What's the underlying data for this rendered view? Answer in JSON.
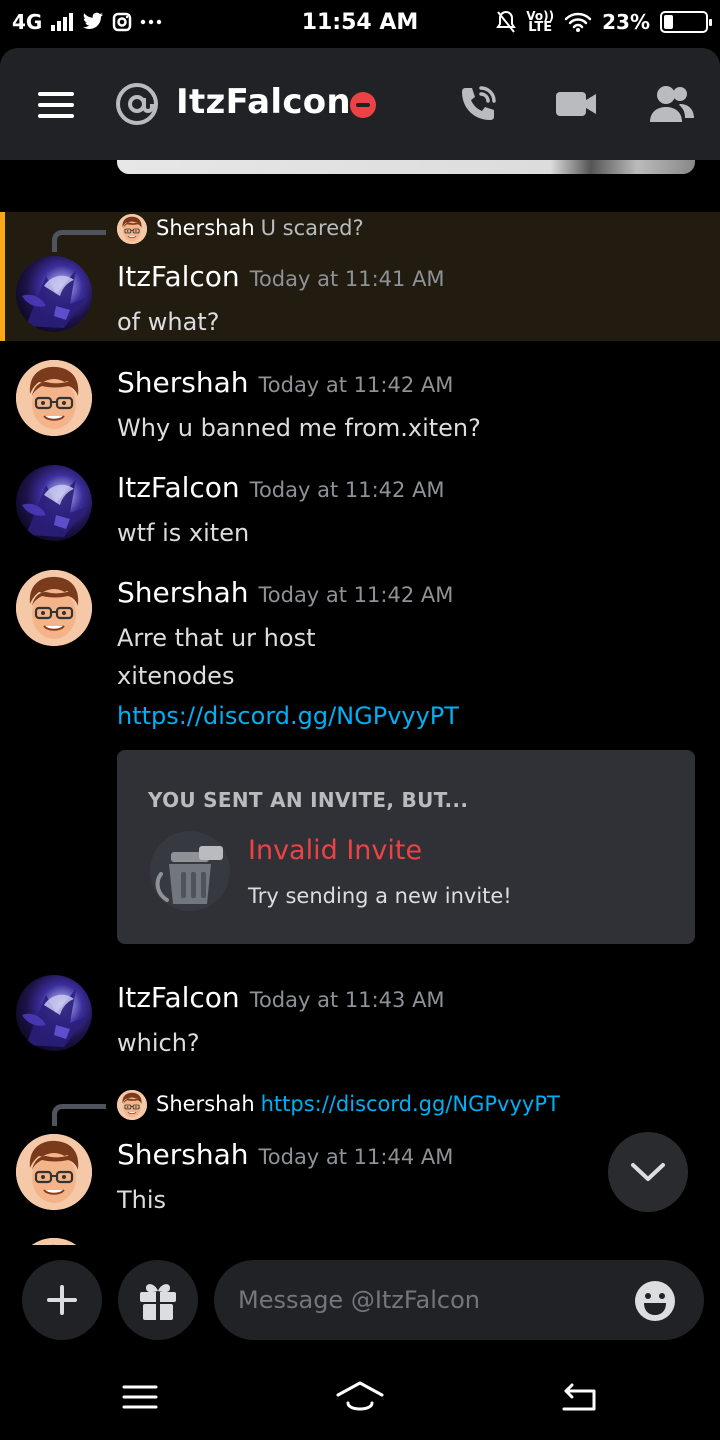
{
  "status_bar": {
    "network": "4G",
    "time": "11:54 AM",
    "lte": "LTE",
    "volte": "Vo))",
    "battery_percent": "23%",
    "battery_level": 0.23,
    "icons": [
      "signal-icon",
      "twitter-icon",
      "instagram-icon",
      "more-dots-icon",
      "mute-icon",
      "volte-icon",
      "wifi-icon",
      "battery-icon"
    ]
  },
  "header": {
    "title": "ItzFalcon",
    "status": "do-not-disturb",
    "icons": [
      "hamburger-icon",
      "at-icon",
      "call-icon",
      "video-icon",
      "members-icon"
    ]
  },
  "colors": {
    "background": "#000000",
    "header": "#202225",
    "highlight": "#211b10",
    "mention_bar": "#faa81a",
    "link": "#00aff4",
    "error": "#ed4245"
  },
  "messages": [
    {
      "reply": {
        "author": "Shershah",
        "text": "U scared?"
      },
      "author": "ItzFalcon",
      "timestamp": "Today at 11:41 AM",
      "lines": [
        "of what?"
      ],
      "highlighted": true
    },
    {
      "author": "Shershah",
      "timestamp": "Today at 11:42 AM",
      "lines": [
        "Why u banned me from.xiten?"
      ]
    },
    {
      "author": "ItzFalcon",
      "timestamp": "Today at 11:42 AM",
      "lines": [
        "wtf is xiten"
      ]
    },
    {
      "author": "Shershah",
      "timestamp": "Today at 11:42 AM",
      "lines": [
        "Arre that ur host",
        "xitenodes"
      ],
      "link": "https://discord.gg/NGPvyyPT",
      "invite": {
        "heading": "YOU SENT AN INVITE, BUT...",
        "title": "Invalid Invite",
        "subtitle": "Try sending a new invite!"
      }
    },
    {
      "author": "ItzFalcon",
      "timestamp": "Today at 11:43 AM",
      "lines": [
        "which?"
      ]
    },
    {
      "reply": {
        "author": "Shershah",
        "link": "https://discord.gg/NGPvyyPT"
      },
      "author": "Shershah",
      "timestamp": "Today at 11:44 AM",
      "lines": [
        "This"
      ]
    }
  ],
  "composer": {
    "placeholder": "Message @ItzFalcon",
    "icons": [
      "plus-icon",
      "gift-icon",
      "emoji-icon"
    ]
  },
  "nav_bar": {
    "icons": [
      "menu-icon",
      "home-icon",
      "back-icon"
    ]
  }
}
